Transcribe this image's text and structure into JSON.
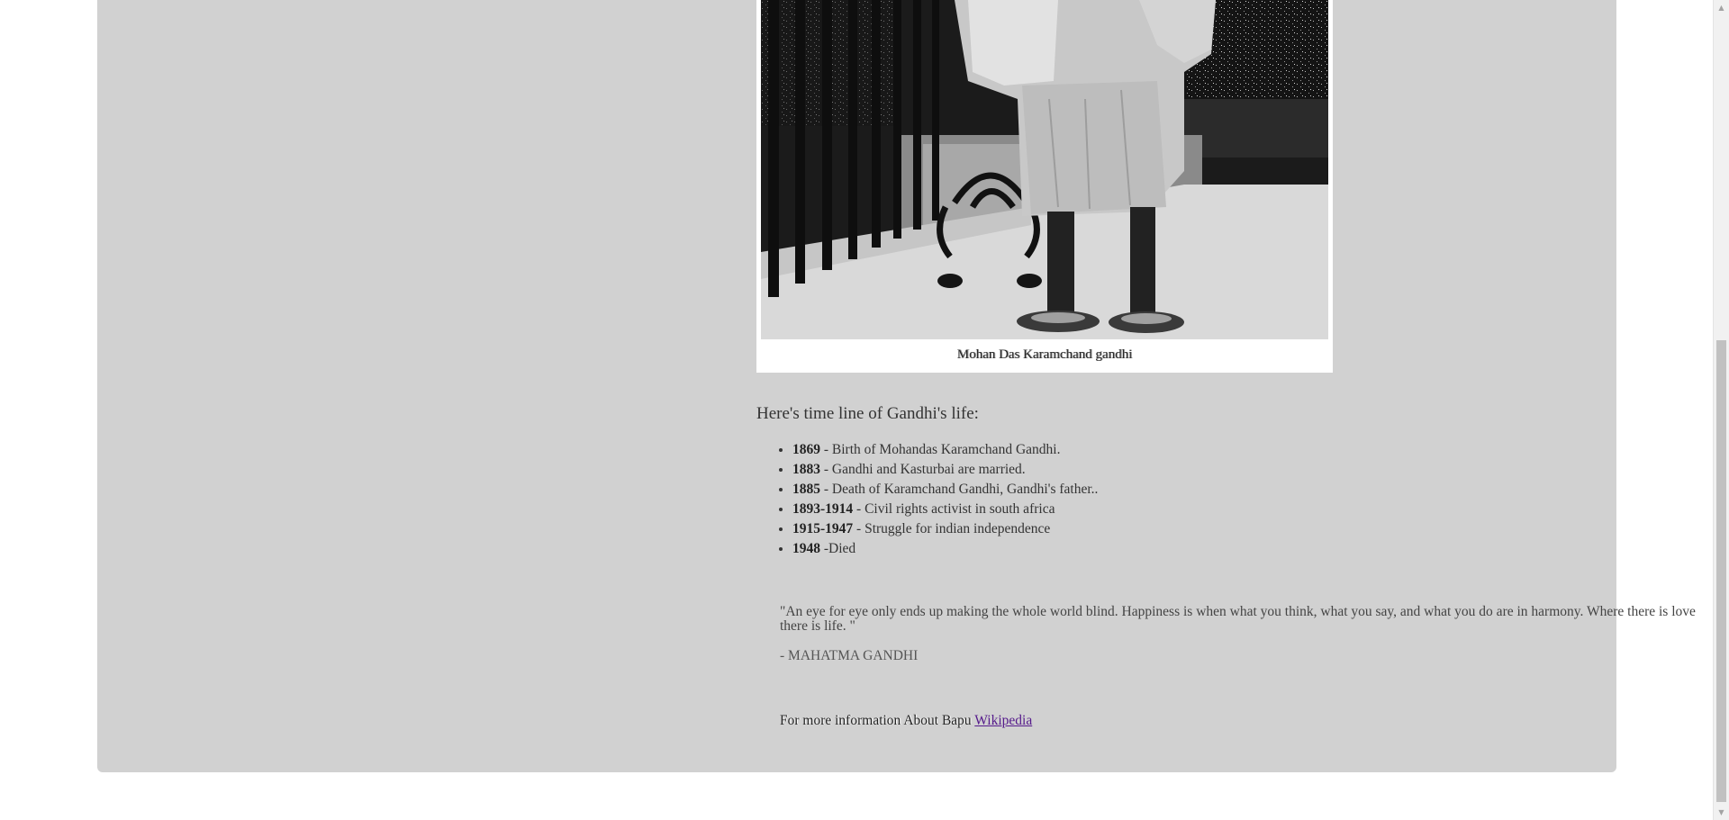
{
  "figure": {
    "caption": "Mohan Das Karamchand gandhi"
  },
  "timeline": {
    "heading": "Here's time line of Gandhi's life:",
    "items": [
      {
        "year": "1869",
        "text": " - Birth of Mohandas Karamchand Gandhi."
      },
      {
        "year": "1883",
        "text": " - Gandhi and Kasturbai are married."
      },
      {
        "year": "1885",
        "text": " - Death of Karamchand Gandhi, Gandhi's father.."
      },
      {
        "year": "1893-1914",
        "text": " - Civil rights activist in south africa"
      },
      {
        "year": "1915-1947",
        "text": " - Struggle for indian independence"
      },
      {
        "year": "1948",
        "text": " -Died"
      }
    ]
  },
  "quote": {
    "text": "\"An eye for eye only ends up making the whole world blind. Happiness is when what you think, what you say, and what you do are in harmony. Where there is love there is life. \"",
    "author": "- MAHATMA GANDHI"
  },
  "footer": {
    "more_info_text": "For more information About Bapu ",
    "link_label": "Wikipedia"
  },
  "scrollbar": {
    "up_icon": "scroll-up-arrow-icon",
    "down_icon": "scroll-down-arrow-icon"
  }
}
